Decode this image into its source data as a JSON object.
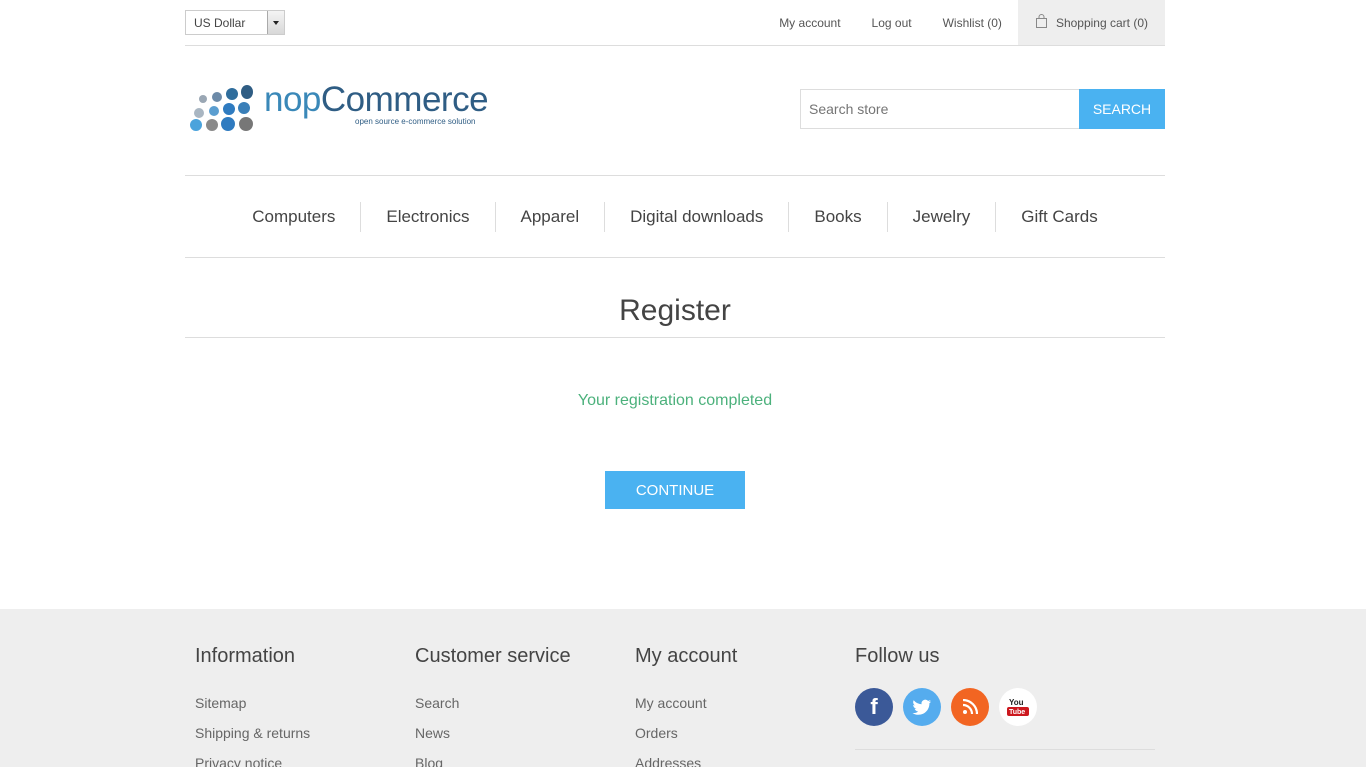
{
  "header": {
    "currency": "US Dollar",
    "links": {
      "my_account": "My account",
      "log_out": "Log out",
      "wishlist": "Wishlist (0)",
      "shopping_cart": "Shopping cart (0)"
    }
  },
  "logo": {
    "title_light": "nop",
    "title_dark": "Commerce",
    "subtitle": "open source e-commerce solution"
  },
  "search": {
    "placeholder": "Search store",
    "button": "Search"
  },
  "menu": [
    "Computers",
    "Electronics",
    "Apparel",
    "Digital downloads",
    "Books",
    "Jewelry",
    "Gift Cards"
  ],
  "page": {
    "title": "Register",
    "result": "Your registration completed",
    "continue": "Continue"
  },
  "footer": {
    "information": {
      "title": "Information",
      "links": [
        "Sitemap",
        "Shipping & returns",
        "Privacy notice"
      ]
    },
    "customer_service": {
      "title": "Customer service",
      "links": [
        "Search",
        "News",
        "Blog"
      ]
    },
    "my_account": {
      "title": "My account",
      "links": [
        "My account",
        "Orders",
        "Addresses"
      ]
    },
    "follow_us": {
      "title": "Follow us",
      "icons": [
        "facebook-icon",
        "twitter-icon",
        "rss-icon",
        "youtube-icon"
      ]
    }
  },
  "colors": {
    "accent": "#4ab2f1",
    "success": "#4cb17c",
    "footer_bg": "#eeeeee"
  }
}
